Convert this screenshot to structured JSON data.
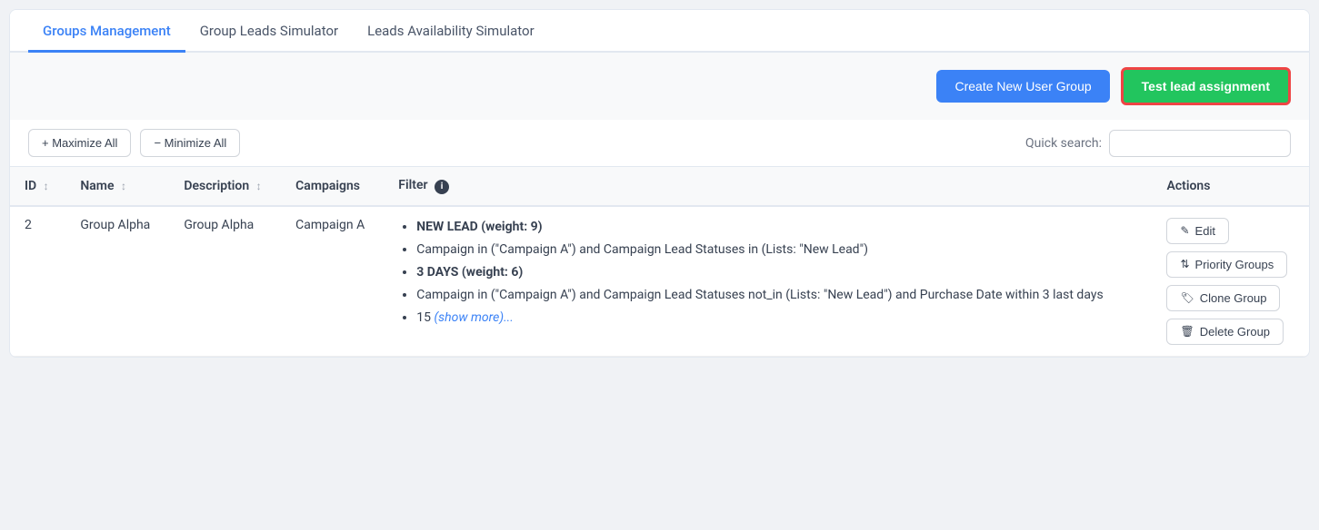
{
  "tabs": [
    {
      "id": "groups-management",
      "label": "Groups Management",
      "active": true
    },
    {
      "id": "group-leads-simulator",
      "label": "Group Leads Simulator",
      "active": false
    },
    {
      "id": "leads-availability-simulator",
      "label": "Leads Availability Simulator",
      "active": false
    }
  ],
  "toolbar": {
    "create_button_label": "Create New User Group",
    "test_button_label": "Test lead assignment"
  },
  "controls": {
    "maximize_label": "+ Maximize All",
    "minimize_label": "− Minimize All",
    "search_label": "Quick search:",
    "search_placeholder": ""
  },
  "table": {
    "columns": [
      {
        "id": "id",
        "label": "ID",
        "sortable": true
      },
      {
        "id": "name",
        "label": "Name",
        "sortable": true
      },
      {
        "id": "description",
        "label": "Description",
        "sortable": true
      },
      {
        "id": "campaigns",
        "label": "Campaigns",
        "sortable": false
      },
      {
        "id": "filter",
        "label": "Filter",
        "sortable": false,
        "info": true
      },
      {
        "id": "actions",
        "label": "Actions",
        "sortable": false
      }
    ],
    "rows": [
      {
        "id": "2",
        "name": "Group Alpha",
        "description": "Group Alpha",
        "campaigns": "Campaign A",
        "filter_items": [
          {
            "text": "NEW LEAD (weight: 9)",
            "bold": true
          },
          {
            "text": "Campaign in (\"Campaign A\") and Campaign Lead Statuses in (Lists: \"New Lead\")",
            "bold": false
          },
          {
            "text": "3 DAYS (weight: 6)",
            "bold": true
          },
          {
            "text": "Campaign in (\"Campaign A\") and Campaign Lead Statuses not_in (Lists: \"New Lead\") and Purchase Date within 3 last days",
            "bold": false
          },
          {
            "text": "15 ",
            "bold": false,
            "show_more": "(show more)..."
          }
        ],
        "actions": [
          {
            "id": "edit",
            "label": "Edit",
            "icon": "✎"
          },
          {
            "id": "priority-groups",
            "label": "Priority Groups",
            "icon": "⇅"
          },
          {
            "id": "clone-group",
            "label": "Clone Group",
            "icon": "🏷"
          },
          {
            "id": "delete-group",
            "label": "Delete Group",
            "icon": "🗑"
          }
        ]
      }
    ]
  }
}
